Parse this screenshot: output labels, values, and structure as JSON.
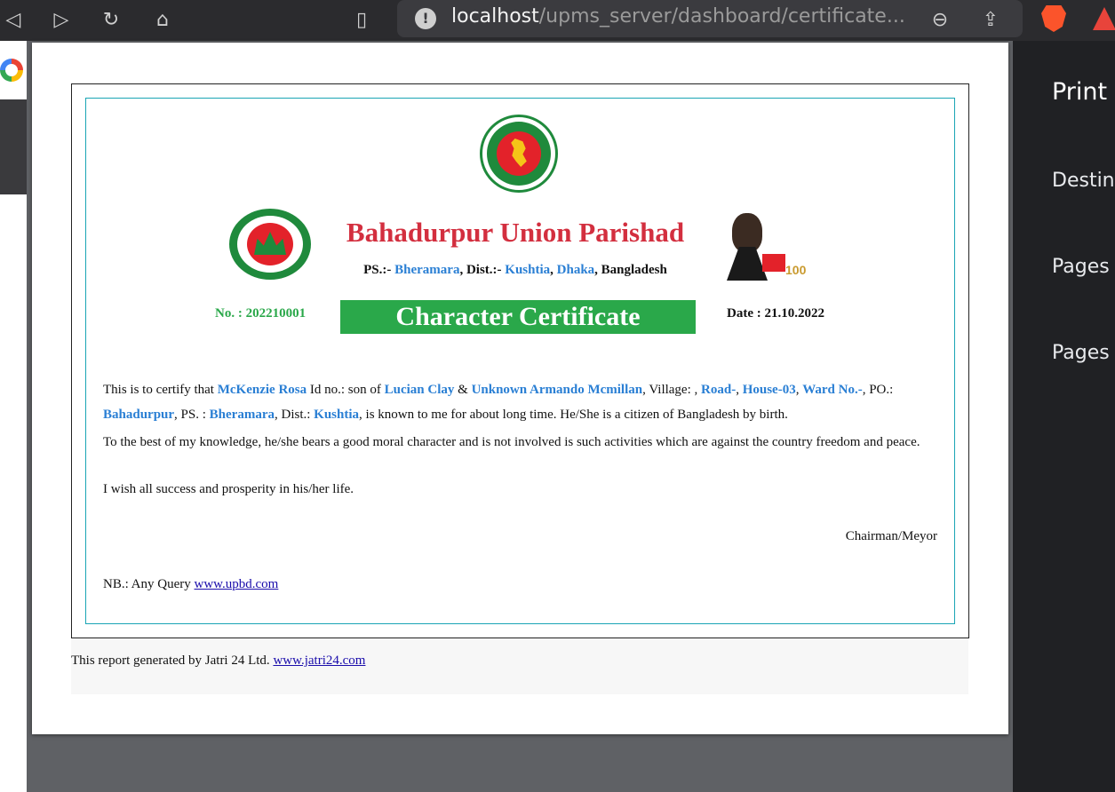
{
  "browser": {
    "url_host": "localhost",
    "url_path": "/upms_server/dashboard/certificate...",
    "nav_icons": [
      "back-icon",
      "forward-icon",
      "reload-icon",
      "home-icon",
      "bookmark-icon",
      "info-icon",
      "zoom-out-icon",
      "share-icon",
      "brave-icon",
      "rewards-icon"
    ]
  },
  "print_panel": {
    "title": "Print",
    "destination_label": "Destin",
    "pages_label": "Pages",
    "pages_per_sheet_label": "Pages"
  },
  "certificate": {
    "union_title": "Bahadurpur Union Parishad",
    "address": {
      "ps_label": "PS.:- ",
      "ps": "Bheramara",
      "dist_label": ", Dist.:- ",
      "dist": "Kushtia",
      "sep": ", ",
      "division": "Dhaka",
      "country": ", Bangladesh"
    },
    "number": "No. : 202210001",
    "title": "Character Certificate",
    "date": "Date : 21.10.2022",
    "paragraph1": {
      "t1": "This is to certify that ",
      "name": "McKenzie Rosa",
      "t2": " Id no.:    son of  ",
      "father": "Lucian Clay",
      "t3": " & ",
      "mother": "Unknown Armando Mcmillan",
      "t4": ", Village: , ",
      "road": "Road-",
      "t5": ", ",
      "house": "House-03",
      "t6": ", ",
      "ward": "Ward No.-",
      "t7": ", PO.: ",
      "po": "Bahadurpur",
      "t8": ", PS. : ",
      "ps": "Bheramara",
      "t9": ", Dist.: ",
      "dist": "Kushtia",
      "t10": ", is known to me for about long time. He/She is a citizen of Bangladesh by birth."
    },
    "paragraph2": "To the best of my knowledge, he/she bears a good moral character and is not involved is such activities which are against the country freedom and peace.",
    "paragraph3": "I wish all success and prosperity in his/her life.",
    "signature": "Chairman/Meyor",
    "nb_text": "NB.: Any Query ",
    "nb_link": "www.upbd.com"
  },
  "footer": {
    "text": "This report generated by Jatri 24 Ltd. ",
    "link": "www.jatri24.com"
  },
  "colors": {
    "title_red": "#d32f3f",
    "accent_green": "#2aa84a",
    "highlight_blue": "#2a7fd4",
    "frame_teal": "#1aa5b5"
  }
}
